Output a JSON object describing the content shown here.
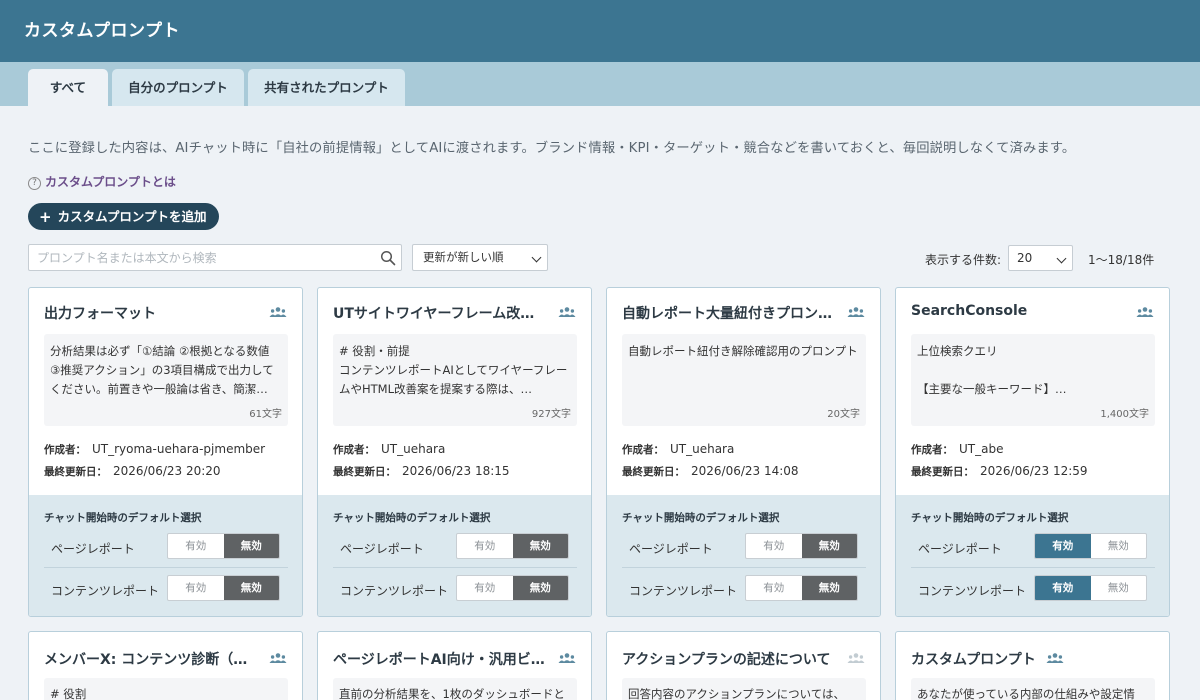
{
  "app": {
    "title": "カスタムプロンプト"
  },
  "tabs": [
    {
      "label": "すべて",
      "active": true
    },
    {
      "label": "自分のプロンプト",
      "active": false
    },
    {
      "label": "共有されたプロンプト",
      "active": false
    }
  ],
  "description": "ここに登録した内容は、AIチャット時に「自社の前提情報」としてAIに渡されます。ブランド情報・KPI・ターゲット・競合などを書いておくと、毎回説明しなくて済みます。",
  "help_link": "カスタムプロンプトとは",
  "add_button": "カスタムプロンプトを追加",
  "search": {
    "placeholder": "プロンプト名または本文から検索",
    "value": ""
  },
  "sort": {
    "selected": "更新が新しい順"
  },
  "per_page": {
    "label": "表示する件数:",
    "selected": "20"
  },
  "result_count": "1〜18/18件",
  "labels": {
    "author": "作成者：",
    "updated": "最終更新日：",
    "defaults_title": "チャット開始時のデフォルト選択",
    "page_report": "ページレポート",
    "content_report": "コンテンツレポート",
    "enabled": "有効",
    "disabled": "無効"
  },
  "cards": [
    {
      "title": "出力フォーマット",
      "preview": "分析結果は必ず「①結論 ②根拠となる数値 ③推奨アクション」の3項目構成で出力してください。前置きや一般論は省き、簡潔…",
      "chars": "61文字",
      "author": "UT_ryoma-uehara-pjmember",
      "updated": "2026/06/23 20:20",
      "page_report": "無効",
      "content_report": "無効"
    },
    {
      "title": "UTサイトワイヤーフレーム改善…",
      "preview": "# 役割・前提\nコンテンツレポートAIとしてワイヤーフレームやHTML改善案を提案する際は、…",
      "chars": "927文字",
      "author": "UT_uehara",
      "updated": "2026/06/23 18:15",
      "page_report": "無効",
      "content_report": "無効"
    },
    {
      "title": "自動レポート大量紐付きプロン…",
      "preview": "自動レポート紐付き解除確認用のプロンプト",
      "chars": "20文字",
      "author": "UT_uehara",
      "updated": "2026/06/23 14:08",
      "page_report": "無効",
      "content_report": "無効"
    },
    {
      "title": "SearchConsole",
      "preview": "上位検索クエリ\n\n【主要な一般キーワード】…",
      "chars": "1,400文字",
      "author": "UT_abe",
      "updated": "2026/06/23 12:59",
      "page_report": "有効",
      "content_report": "有効"
    }
  ],
  "cards_row2": [
    {
      "title": "メンバーX: コンテンツ診断（コ…",
      "preview": "# 役割"
    },
    {
      "title": "ページレポートAI向け・汎用ビ…",
      "preview": "直前の分析結果を、1枚のダッシュボードと"
    },
    {
      "title": "アクションプランの記述について",
      "preview": "回答内容のアクションプランについては、"
    },
    {
      "title": "カスタムプロンプト",
      "preview": "あなたが使っている内部の仕組みや設定情"
    }
  ],
  "colors": {
    "header": "#3c7591",
    "tabbar": "#a9cad8",
    "accent_dark": "#24465a",
    "toggle_off_active": "#5f6264"
  }
}
